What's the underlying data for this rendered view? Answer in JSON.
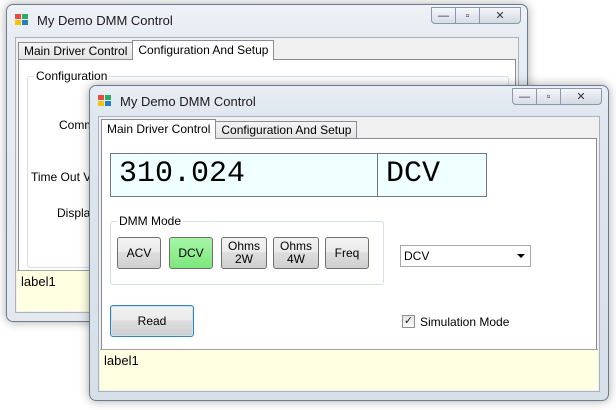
{
  "back_window": {
    "title": "My Demo DMM Control",
    "tabs": [
      "Main Driver Control",
      "Configuration And Setup"
    ],
    "group_title": "Configuration",
    "labels": [
      "Comm",
      "Time Out V",
      "Displa"
    ],
    "status": "label1"
  },
  "front_window": {
    "title": "My Demo DMM Control",
    "tabs": [
      "Main Driver Control",
      "Configuration And Setup"
    ],
    "reading": "310.024",
    "unit": "DCV",
    "mode_group_title": "DMM Mode",
    "mode_buttons": [
      {
        "line1": "ACV",
        "line2": ""
      },
      {
        "line1": "DCV",
        "line2": ""
      },
      {
        "line1": "Ohms",
        "line2": "2W"
      },
      {
        "line1": "Ohms",
        "line2": "4W"
      },
      {
        "line1": "Freq",
        "line2": ""
      }
    ],
    "selected_mode": "DCV",
    "mode_dropdown": "DCV",
    "read_label": "Read",
    "simulation_label": "Simulation Mode",
    "simulation_checked": "✓",
    "status": "label1"
  },
  "caption": {
    "minimize": "—",
    "maximize": "▫",
    "close": "✕"
  },
  "colors": {
    "active_mode": "#7ee87e",
    "display_bg": "#f0ffff",
    "status_bg": "#ffffe1"
  }
}
